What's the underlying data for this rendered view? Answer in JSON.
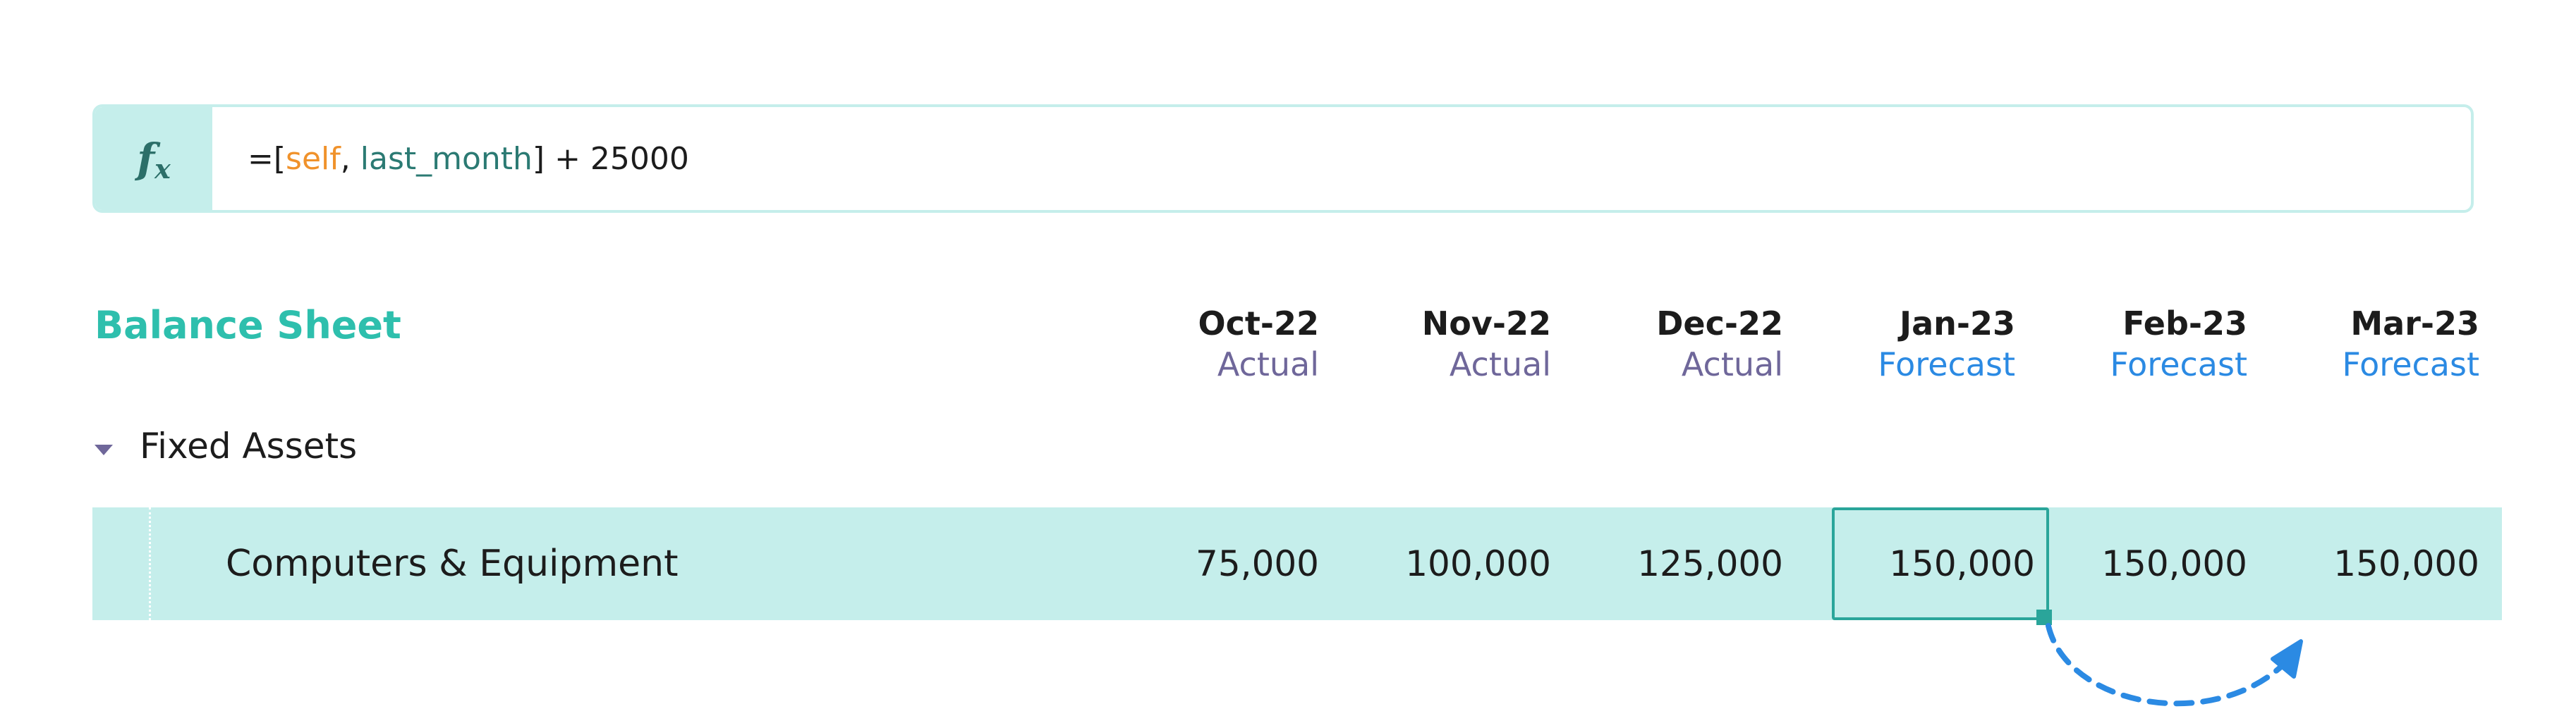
{
  "formula_bar": {
    "icon": "fx-icon",
    "icon_main": "f",
    "icon_sub": "x",
    "prefix": "=[",
    "token_self": "self",
    "separator": ", ",
    "token_ref": "last_month",
    "suffix": "] + 25000"
  },
  "sheet": {
    "title": "Balance Sheet",
    "columns": [
      {
        "month": "Oct-22",
        "kind": "Actual"
      },
      {
        "month": "Nov-22",
        "kind": "Actual"
      },
      {
        "month": "Dec-22",
        "kind": "Actual"
      },
      {
        "month": "Jan-23",
        "kind": "Forecast"
      },
      {
        "month": "Feb-23",
        "kind": "Forecast"
      },
      {
        "month": "Mar-23",
        "kind": "Forecast"
      }
    ],
    "group": {
      "label": "Fixed Assets",
      "icon": "caret-down-icon",
      "rows": [
        {
          "label": "Computers & Equipment",
          "values": [
            "75,000",
            "100,000",
            "125,000",
            "150,000",
            "150,000",
            "150,000"
          ],
          "selected_index": 3
        }
      ]
    }
  },
  "colors": {
    "accent": "#2ebfad",
    "row_highlight": "#c5eeeb",
    "actual": "#6f679a",
    "forecast": "#2b8ae3",
    "token_self": "#f0922b",
    "token_ref": "#2b7a73"
  },
  "drag_icon": "drag-fill-arrow-icon"
}
